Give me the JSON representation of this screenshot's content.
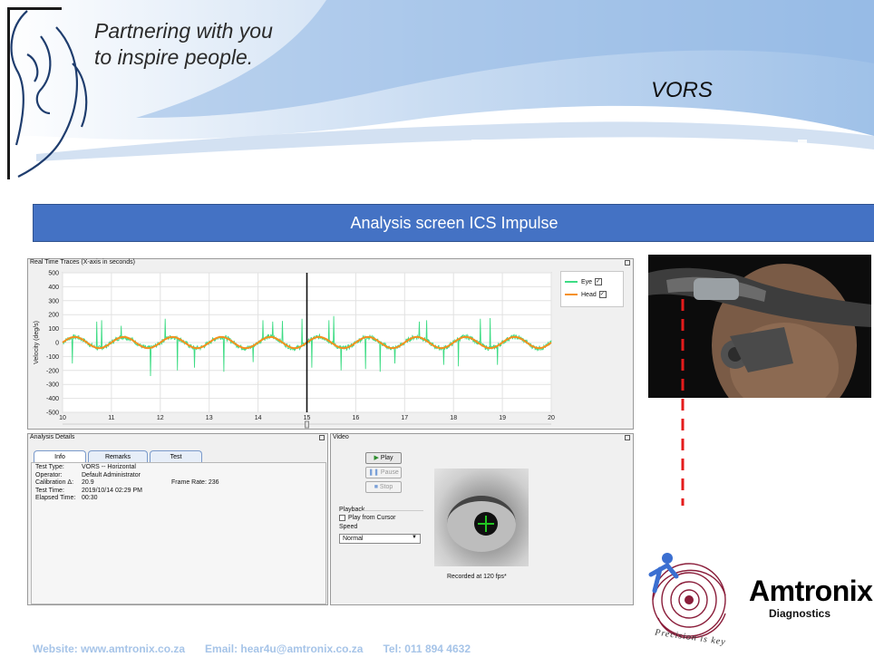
{
  "header": {
    "tagline_line1": "Partnering with you",
    "tagline_line2": "to inspire people.",
    "test_name": "VORS"
  },
  "slide_title": "Analysis screen ICS Impulse",
  "traces_panel": {
    "title": "Real Time Traces (X-axis in seconds)",
    "legend": [
      {
        "label": "Eye",
        "checked": true,
        "color": "#3ddc84"
      },
      {
        "label": "Head",
        "checked": true,
        "color": "#f5901e"
      }
    ]
  },
  "chart_data": {
    "type": "line",
    "title": "Real Time Traces (X-axis in seconds)",
    "xlabel": "",
    "ylabel": "Velocity (deg/s)",
    "xlim": [
      10,
      20
    ],
    "ylim": [
      -500,
      500
    ],
    "x_ticks": [
      "10",
      "11",
      "12",
      "13",
      "14",
      "15",
      "16",
      "17",
      "18",
      "19",
      "20"
    ],
    "y_ticks": [
      "500",
      "400",
      "300",
      "200",
      "100",
      "0",
      "-100",
      "-200",
      "-300",
      "-400",
      "-500"
    ],
    "cursor_x": 15,
    "series": [
      {
        "name": "Eye",
        "color": "#3ddc84",
        "impulses": [
          [
            10.2,
            -150
          ],
          [
            10.7,
            150
          ],
          [
            10.8,
            160
          ],
          [
            11.2,
            120
          ],
          [
            11.8,
            -240
          ],
          [
            12.1,
            170
          ],
          [
            12.35,
            -200
          ],
          [
            12.7,
            -180
          ],
          [
            13.3,
            -210
          ],
          [
            13.9,
            -140
          ],
          [
            14.1,
            160
          ],
          [
            14.3,
            150
          ],
          [
            14.5,
            155
          ],
          [
            14.9,
            170
          ],
          [
            15.1,
            -180
          ],
          [
            15.45,
            160
          ],
          [
            15.55,
            190
          ],
          [
            15.7,
            -200
          ],
          [
            16.2,
            -190
          ],
          [
            16.5,
            -210
          ],
          [
            16.8,
            -150
          ],
          [
            17.3,
            150
          ],
          [
            17.45,
            160
          ],
          [
            17.8,
            -160
          ],
          [
            18.1,
            -170
          ],
          [
            18.55,
            170
          ],
          [
            18.75,
            175
          ],
          [
            18.9,
            -160
          ]
        ]
      },
      {
        "name": "Head",
        "color": "#f5901e",
        "period_s": 1.0,
        "amplitude": 40
      }
    ],
    "legend_position": "top-right",
    "grid": true
  },
  "analysis_details": {
    "title": "Analysis Details",
    "tabs": [
      "Info",
      "Remarks",
      "Test"
    ],
    "fields": [
      {
        "label": "Test Type:",
        "value": "VORS -- Horizontal"
      },
      {
        "label": "Operator:",
        "value": "Default Administrator"
      },
      {
        "label": "Calibration Δ:",
        "value": "20.9"
      },
      {
        "label": "Test Time:",
        "value": "2019/10/14 02:29 PM"
      },
      {
        "label": "Elapsed Time:",
        "value": "00:30"
      }
    ],
    "frame_rate": "Frame Rate: 236"
  },
  "video": {
    "title": "Video",
    "play": "Play",
    "pause": "Pause",
    "stop": "Stop",
    "playback_label": "Playback",
    "play_from_cursor": "Play from Cursor",
    "speed_label": "Speed",
    "speed_value": "Normal",
    "recorded": "Recorded at 120 fps*"
  },
  "logo": {
    "name": "Amtronix",
    "sub": "Diagnostics",
    "ring_text": "Precision is key"
  },
  "footer": {
    "website": "Website: www.amtronix.co.za",
    "email": "Email: hear4u@amtronix.co.za",
    "tel": "Tel: 011 894 4632"
  }
}
